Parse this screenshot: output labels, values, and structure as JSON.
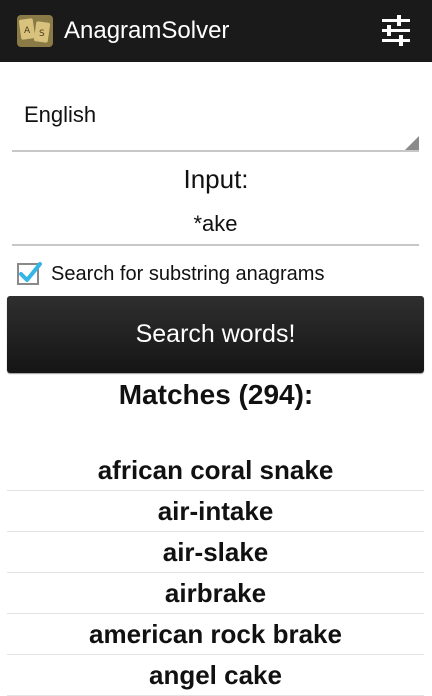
{
  "app": {
    "title": "AnagramSolver",
    "icon": "anagram-tiles-icon",
    "settings_icon": "sliders-icon"
  },
  "language": {
    "selected": "English"
  },
  "input": {
    "label": "Input:",
    "value": "*ake"
  },
  "options": {
    "substring_label": "Search for substring anagrams",
    "substring_checked": true
  },
  "search_button_label": "Search words!",
  "results": {
    "title": "Matches (294):",
    "items": [
      "african coral snake",
      "air-intake",
      "air-slake",
      "airbrake",
      "american rock brake",
      "angel cake"
    ]
  },
  "colors": {
    "action_bar": "#1a1a1a",
    "checkbox_check": "#33b5e5",
    "button": "#1f1f1f"
  }
}
